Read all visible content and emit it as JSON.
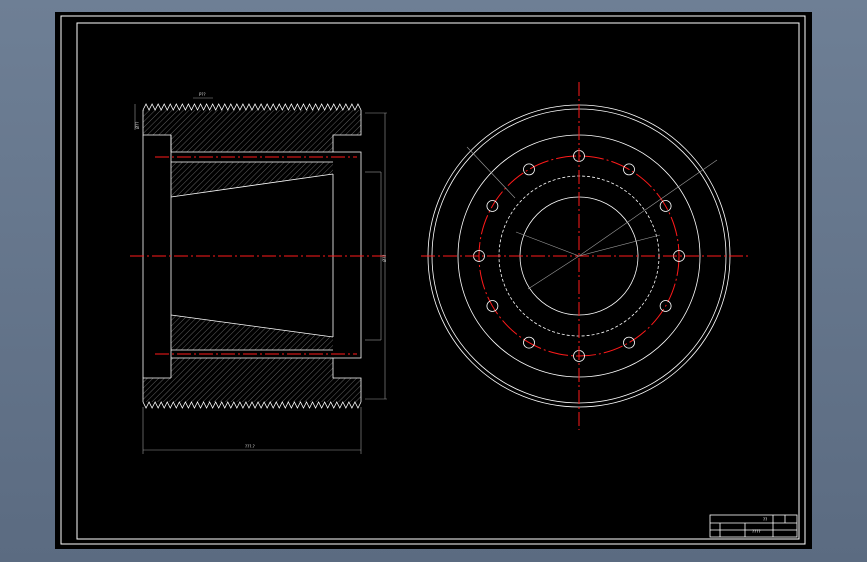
{
  "drawing": {
    "background_color": "#000000",
    "line_color": "#ffffff",
    "centerline_color": "#ff1a1a",
    "views": [
      "section-view",
      "front-view"
    ],
    "dimensions": {
      "top_pitch": "P??",
      "left_height": "Ø??",
      "bottom_width": "???.?",
      "right_bore": "Ø??"
    },
    "title_block": {
      "part_name": "????",
      "mark": "??"
    }
  }
}
